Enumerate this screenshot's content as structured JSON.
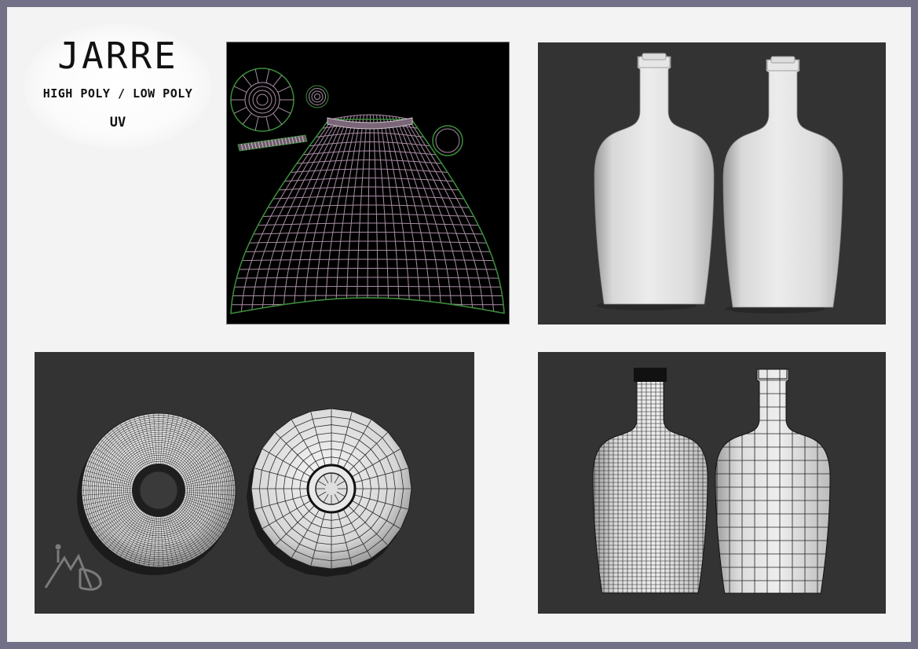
{
  "title": {
    "main": "JARRE",
    "subtitle": "HIGH POLY / LOW POLY",
    "uv_label": "UV"
  },
  "colors": {
    "frame": "#727087",
    "sheet": "#f3f3f3",
    "viewport": "#333333",
    "uv_background": "#000000",
    "uv_edge": "#3a8f3a",
    "model_light": "#e2e2e2"
  },
  "logo": {
    "icon": "studio-logo-watermark"
  }
}
